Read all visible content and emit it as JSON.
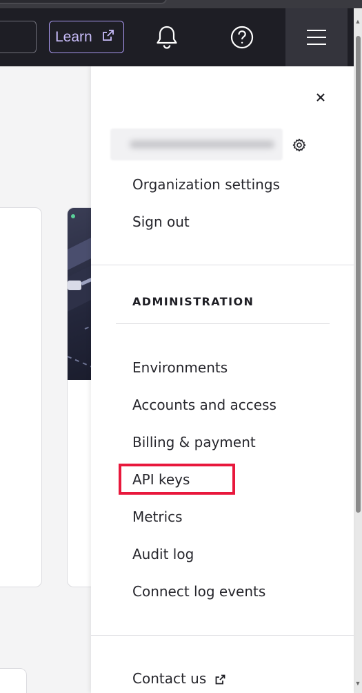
{
  "header": {
    "learn_label": "Learn",
    "icons": [
      "bell-icon",
      "help-icon",
      "hamburger-menu-icon",
      "external-link-icon"
    ]
  },
  "menu": {
    "user_links": [
      "Organization settings",
      "Sign out"
    ],
    "admin_section_title": "ADMINISTRATION",
    "admin_links": [
      "Environments",
      "Accounts and access",
      "Billing & payment",
      "API keys",
      "Metrics",
      "Audit log",
      "Connect log events"
    ],
    "highlighted_item": "API keys",
    "footer_links": [
      "Contact us"
    ]
  },
  "colors": {
    "header_bg": "#1e1e25",
    "learn_accent": "#a998f0",
    "highlight": "#e8183c",
    "panel_bg": "#ffffff"
  }
}
